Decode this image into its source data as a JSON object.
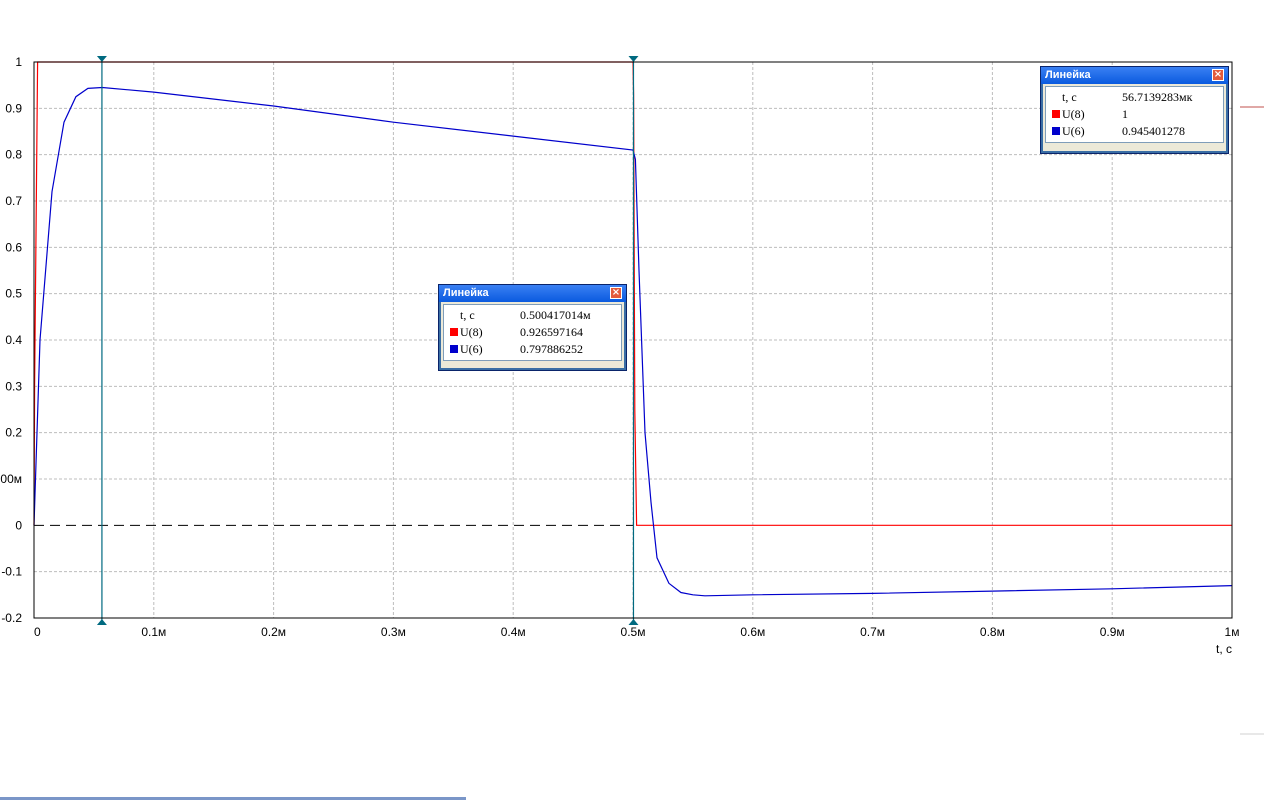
{
  "chart_data": {
    "type": "line",
    "x_unit": "t, c",
    "x_tick_labels": [
      "0",
      "0.1м",
      "0.2м",
      "0.3м",
      "0.4м",
      "0.5м",
      "0.6м",
      "0.7м",
      "0.8м",
      "0.9м",
      "1м"
    ],
    "y_tick_labels": [
      "1",
      "0.9",
      "0.8",
      "0.7",
      "0.6",
      "0.5",
      "0.4",
      "0.3",
      "0.2",
      "00м",
      "0",
      "-0.1",
      "-0.2"
    ],
    "xlim": [
      0,
      1.0
    ],
    "ylim": [
      -0.2,
      1.0
    ],
    "x_scale": "ms",
    "grid": true,
    "series": [
      {
        "name": "U(8)",
        "color": "#ff0000",
        "x": [
          0,
          0.0005,
          0.003,
          0.004,
          0.5,
          0.5005,
          0.5015,
          0.503,
          0.5035,
          1.0
        ],
        "y": [
          0,
          0.3,
          1.0,
          1.0,
          1.0,
          0.93,
          0.25,
          0.0,
          0.0,
          0.0
        ]
      },
      {
        "name": "U(6)",
        "color": "#0000cc",
        "x": [
          0,
          0.005,
          0.015,
          0.025,
          0.035,
          0.045,
          0.057,
          0.1,
          0.2,
          0.3,
          0.4,
          0.5,
          0.502,
          0.505,
          0.51,
          0.515,
          0.52,
          0.53,
          0.54,
          0.55,
          0.56,
          0.6,
          0.7,
          0.8,
          0.9,
          1.0
        ],
        "y": [
          0,
          0.4,
          0.72,
          0.87,
          0.925,
          0.943,
          0.945,
          0.935,
          0.905,
          0.87,
          0.84,
          0.81,
          0.79,
          0.55,
          0.2,
          0.05,
          -0.07,
          -0.125,
          -0.145,
          -0.15,
          -0.152,
          -0.15,
          -0.147,
          -0.142,
          -0.137,
          -0.13
        ]
      }
    ],
    "zero_line": "dashed",
    "cursors": [
      {
        "t_ms": 0.0567
      },
      {
        "t_ms": 0.5004
      }
    ]
  },
  "ruler_windows": [
    {
      "title": "Линейка",
      "close": "×",
      "rows": [
        {
          "name": "t, c",
          "value": "56.7139283мк",
          "color": ""
        },
        {
          "name": "U(8)",
          "value": "1",
          "color": "#ff0000"
        },
        {
          "name": "U(6)",
          "value": "0.945401278",
          "color": "#0000cc"
        }
      ]
    },
    {
      "title": "Линейка",
      "close": "×",
      "rows": [
        {
          "name": "t, c",
          "value": "0.500417014м",
          "color": ""
        },
        {
          "name": "U(8)",
          "value": "0.926597164",
          "color": "#ff0000"
        },
        {
          "name": "U(6)",
          "value": "0.797886252",
          "color": "#0000cc"
        }
      ]
    }
  ]
}
